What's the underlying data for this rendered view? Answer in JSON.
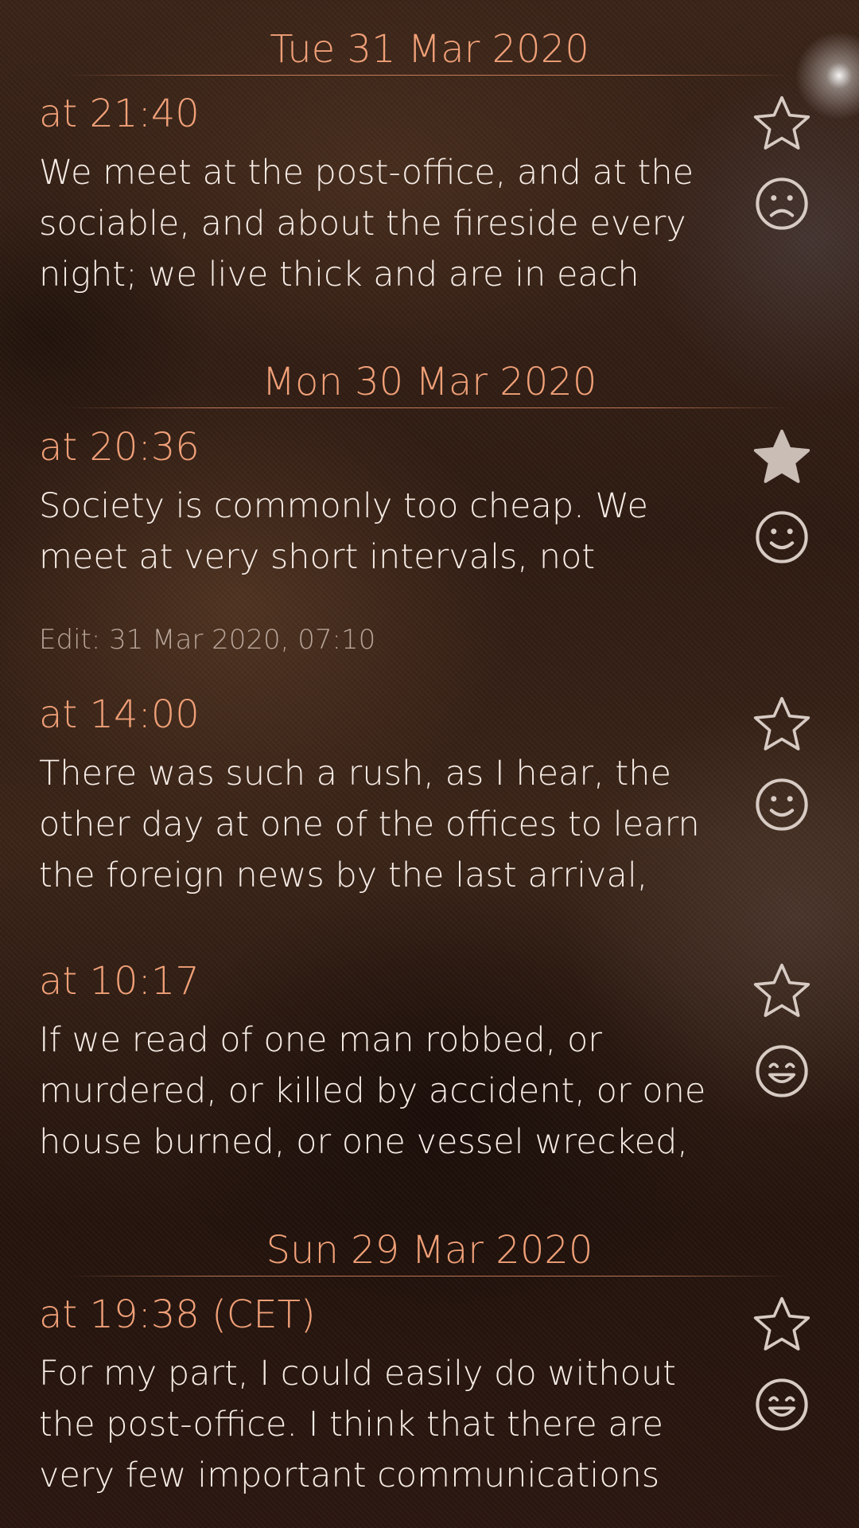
{
  "days": [
    {
      "date": "Tue 31 Mar 2020",
      "entries": [
        {
          "time": "at 21:40",
          "text": "We meet at the post-office, and at the sociable, and about the fireside every night; we live thick and are in each othe…",
          "favorite": false,
          "favorite_icon": "star-outline-icon",
          "mood": "sad",
          "mood_icon": "sad-face-icon",
          "edit": ""
        }
      ]
    },
    {
      "date": "Mon 30 Mar 2020",
      "entries": [
        {
          "time": "at 20:36",
          "text": "Society is commonly too cheap. We meet at very short intervals, not having had ti…",
          "favorite": true,
          "favorite_icon": "star-filled-icon",
          "mood": "happy",
          "mood_icon": "smiley-face-icon",
          "edit": "Edit: 31 Mar 2020, 07:10"
        },
        {
          "time": "at 14:00",
          "text": "There was such a rush, as I hear, the other day at one of the offices to learn the foreign news by the last arrival, that sev…",
          "favorite": false,
          "favorite_icon": "star-outline-icon",
          "mood": "happy",
          "mood_icon": "smiley-face-icon",
          "edit": ""
        },
        {
          "time": "at 10:17",
          "text": "If we read of one man robbed, or murdered, or killed by accident, or one house burned, or one vessel wrecked, o…",
          "favorite": false,
          "favorite_icon": "star-outline-icon",
          "mood": "very happy",
          "mood_icon": "grinning-face-icon",
          "edit": ""
        }
      ]
    },
    {
      "date": "Sun 29 Mar 2020",
      "entries": [
        {
          "time": "at 19:38 (CET)",
          "text": "For my part, I could easily do without the post-office. I think that there are very few important communications made thro…",
          "favorite": false,
          "favorite_icon": "star-outline-icon",
          "mood": "very happy",
          "mood_icon": "grinning-face-icon",
          "edit": ""
        }
      ]
    }
  ],
  "colors": {
    "accent": "#f0a078",
    "text": "#f6ece6",
    "secondary": "#b8a59a",
    "icon": "#d7cbc4"
  }
}
